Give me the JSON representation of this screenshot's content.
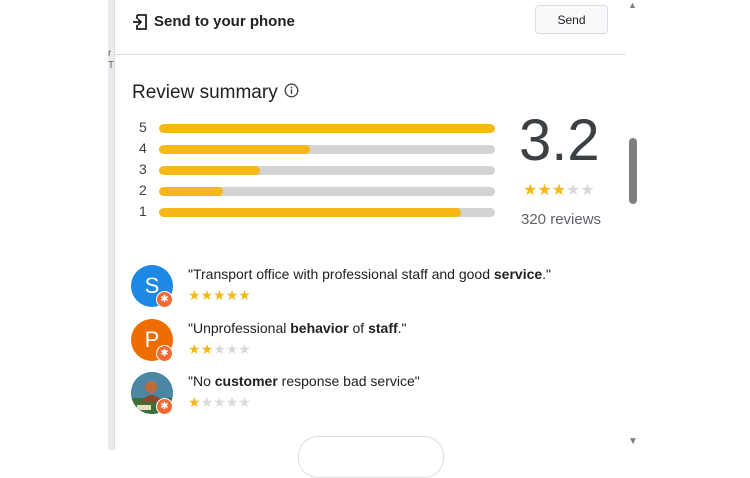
{
  "map": {
    "label_1": "r",
    "label_2": "T"
  },
  "send": {
    "label": "Send to your phone",
    "button": "Send"
  },
  "summary": {
    "title": "Review summary",
    "rating": "3.2",
    "stars_filled": 3,
    "reviews": "320 reviews",
    "bars": [
      {
        "label": "5",
        "fraction": 1.0
      },
      {
        "label": "4",
        "fraction": 0.45
      },
      {
        "label": "3",
        "fraction": 0.3
      },
      {
        "label": "2",
        "fraction": 0.19
      },
      {
        "label": "1",
        "fraction": 0.9
      }
    ]
  },
  "reviews": [
    {
      "avatar_letter": "S",
      "avatar_color": "#1e88e5",
      "parts": [
        {
          "text": "\"Transport office with professional staff and good ",
          "bold": false
        },
        {
          "text": "service",
          "bold": true
        },
        {
          "text": ".\"",
          "bold": false
        }
      ],
      "stars": 5
    },
    {
      "avatar_letter": "P",
      "avatar_color": "#ef6c00",
      "parts": [
        {
          "text": "\"Unprofessional ",
          "bold": false
        },
        {
          "text": "behavior",
          "bold": true
        },
        {
          "text": " of ",
          "bold": false
        },
        {
          "text": "staff",
          "bold": true
        },
        {
          "text": ".\"",
          "bold": false
        }
      ],
      "stars": 2
    },
    {
      "avatar_letter": "",
      "avatar_color": "#5a8fa8",
      "parts": [
        {
          "text": "\"No ",
          "bold": false
        },
        {
          "text": "customer",
          "bold": true
        },
        {
          "text": " response bad service\"",
          "bold": false
        }
      ],
      "stars": 1
    }
  ],
  "icons": {
    "send": "send-to-phone-icon",
    "info": "info-icon",
    "badge": "local-guide-badge-icon"
  },
  "colors": {
    "star": "#f5b818",
    "star_empty": "#d9d9d9",
    "bar_track": "#d3d3d3"
  }
}
